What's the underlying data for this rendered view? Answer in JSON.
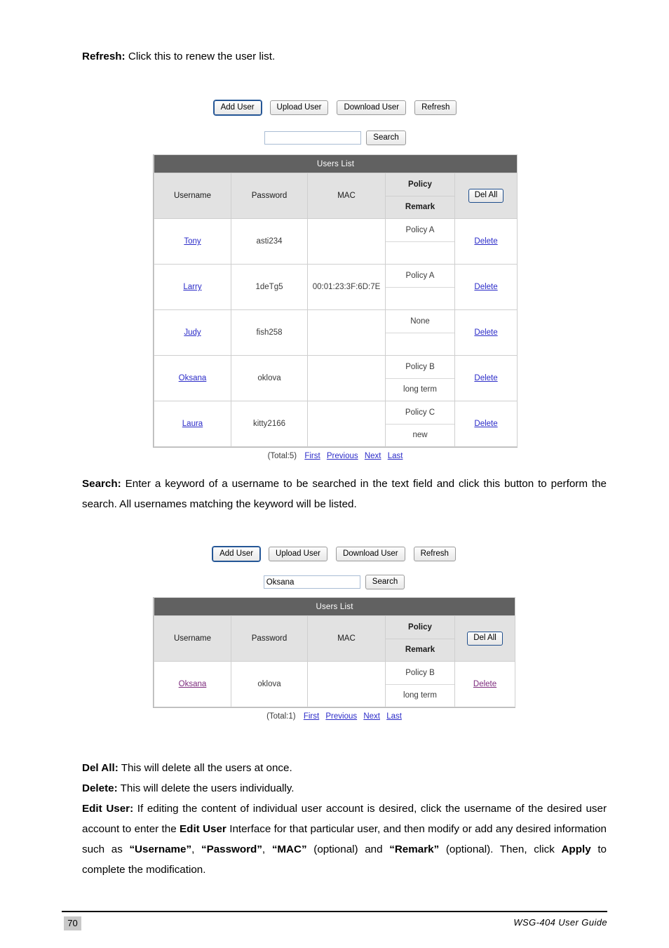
{
  "document": {
    "footer": {
      "page_number": "70",
      "guide_title": "WSG-404 User Guide"
    }
  },
  "paragraphs": {
    "refresh": {
      "term": "Refresh:",
      "text": " Click this to renew the user list."
    },
    "search": {
      "term": "Search:",
      "text": " Enter a keyword of a username to be searched in the text field and click this button to perform the search. All usernames matching the keyword will be listed."
    },
    "del_all": {
      "term": "Del All:",
      "text": " This will delete all the users at once."
    },
    "delete": {
      "term": "Delete:",
      "text": " This will delete the users individually."
    },
    "edit_user": {
      "term": "Edit User:",
      "part1": " If editing the content of individual user account is desired, click the username of the desired user account to enter the ",
      "bold1": "Edit User",
      "part2": " Interface for that particular user, and then modify or add any desired information such as ",
      "bold2": "“Username”",
      "part3": ", ",
      "bold3": "“Password”",
      "part4": ", ",
      "bold4": "“MAC”",
      "part5": " (optional) and ",
      "bold5": "“Remark”",
      "part6": " (optional). Then, click ",
      "bold6": "Apply",
      "part7": " to complete the modification."
    }
  },
  "screenshot_one": {
    "toolbar": {
      "add_user": "Add User",
      "upload_user": "Upload User",
      "download_user": "Download User",
      "refresh": "Refresh"
    },
    "search": {
      "value": "",
      "placeholder": "",
      "button_label": "Search"
    },
    "table": {
      "title": "Users List",
      "columns": {
        "username": "Username",
        "password": "Password",
        "mac": "MAC",
        "policy": "Policy",
        "remark": "Remark"
      },
      "del_all_label": "Del All",
      "rows": [
        {
          "username": "Tony",
          "password": "asti234",
          "mac": "",
          "policy": "Policy A",
          "remark": "",
          "delete_label": "Delete"
        },
        {
          "username": "Larry",
          "password": "1deTg5",
          "mac": "00:01:23:3F:6D:7E",
          "policy": "Policy A",
          "remark": "",
          "delete_label": "Delete"
        },
        {
          "username": "Judy",
          "password": "fish258",
          "mac": "",
          "policy": "None",
          "remark": "",
          "delete_label": "Delete"
        },
        {
          "username": "Oksana",
          "password": "oklova",
          "mac": "",
          "policy": "Policy B",
          "remark": "long term",
          "delete_label": "Delete"
        },
        {
          "username": "Laura",
          "password": "kitty2166",
          "mac": "",
          "policy": "Policy C",
          "remark": "new",
          "delete_label": "Delete"
        }
      ]
    },
    "pager": {
      "total": "(Total:5)",
      "first": "First",
      "previous": "Previous",
      "next": "Next",
      "last": "Last"
    }
  },
  "screenshot_two": {
    "toolbar": {
      "add_user": "Add User",
      "upload_user": "Upload User",
      "download_user": "Download User",
      "refresh": "Refresh"
    },
    "search": {
      "value": "Oksana",
      "placeholder": "",
      "button_label": "Search"
    },
    "table": {
      "title": "Users List",
      "columns": {
        "username": "Username",
        "password": "Password",
        "mac": "MAC",
        "policy": "Policy",
        "remark": "Remark"
      },
      "del_all_label": "Del All",
      "rows": [
        {
          "username": "Oksana",
          "password": "oklova",
          "mac": "",
          "policy": "Policy B",
          "remark": "long term",
          "delete_label": "Delete"
        }
      ]
    },
    "pager": {
      "total": "(Total:1)",
      "first": "First",
      "previous": "Previous",
      "next": "Next",
      "last": "Last"
    }
  },
  "colors": {
    "table_title_bar": "#616161",
    "table_header_bg": "#e2e2e2",
    "link": "#2b2bc8",
    "visited_link": "#7d2b7d",
    "focus_border": "#1f4e8c"
  }
}
